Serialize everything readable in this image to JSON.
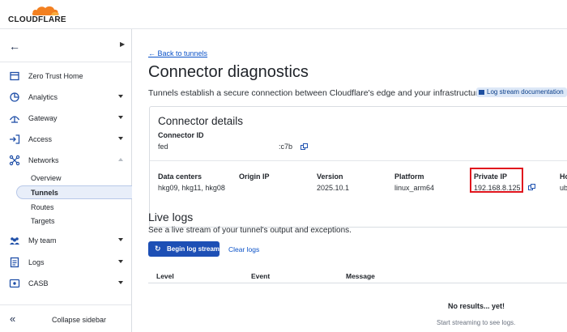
{
  "header": {
    "logo_text": "CLOUDFLARE",
    "colors": {
      "cloud_orange": "#f38020",
      "cloud_light": "#faae40"
    }
  },
  "sidebar": {
    "back_icon": "arrow-left-icon",
    "expand_icon": "chevron-right-icon",
    "items": [
      {
        "label": "Zero Trust Home",
        "icon": "home-icon"
      },
      {
        "label": "Analytics",
        "icon": "analytics-icon"
      },
      {
        "label": "Gateway",
        "icon": "gateway-icon"
      },
      {
        "label": "Access",
        "icon": "access-icon"
      },
      {
        "label": "Networks",
        "icon": "networks-icon"
      },
      {
        "label": "My team",
        "icon": "team-icon"
      },
      {
        "label": "Logs",
        "icon": "logs-icon"
      },
      {
        "label": "CASB",
        "icon": "casb-icon"
      }
    ],
    "networks_sub": [
      "Overview",
      "Tunnels",
      "Routes",
      "Targets"
    ],
    "collapse_label": "Collapse sidebar"
  },
  "main": {
    "back_link": "← Back to tunnels",
    "title": "Connector diagnostics",
    "description": "Tunnels establish a secure connection between Cloudflare's edge and your infrastructure.",
    "doc_badge": "Log stream documentation",
    "details": {
      "title": "Connector details",
      "connector_id_label": "Connector ID",
      "connector_id_prefix": "fed",
      "connector_id_suffix": ":c7b",
      "columns": [
        {
          "label": "Data centers",
          "value": "hkg09, hkg11, hkg08"
        },
        {
          "label": "Origin IP",
          "value": ""
        },
        {
          "label": "Version",
          "value": "2025.10.1"
        },
        {
          "label": "Platform",
          "value": "linux_arm64"
        },
        {
          "label": "Private IP",
          "value": "192.168.8.125"
        },
        {
          "label": "Ho",
          "value": "ub"
        }
      ]
    },
    "live_logs": {
      "title": "Live logs",
      "description": "See a live stream of your tunnel's output and exceptions.",
      "begin_button": "Begin log stream",
      "clear_button": "Clear logs",
      "columns": [
        "Level",
        "Event",
        "Message"
      ],
      "empty_title": "No results... yet!",
      "empty_desc": "Start streaming to see logs."
    },
    "accent_color": "#1d4fb5",
    "highlight_color": "#e0141d"
  }
}
